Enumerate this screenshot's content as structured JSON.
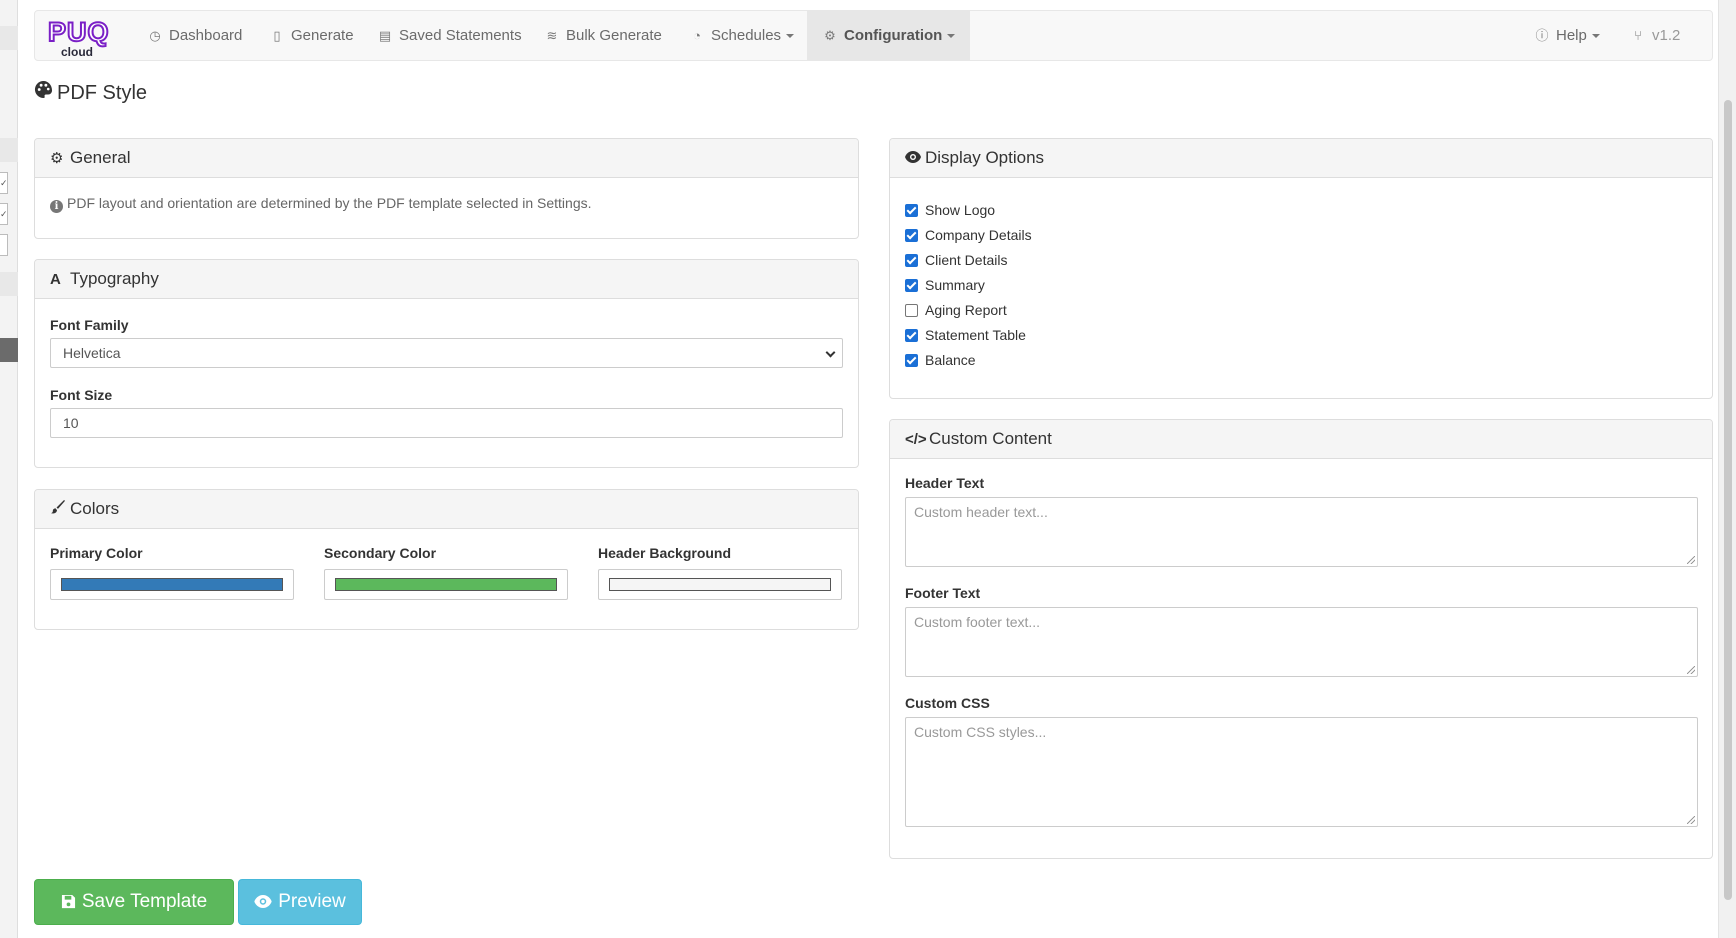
{
  "navbar": {
    "brand_text": "PUQ",
    "brand_sub": "cloud",
    "items": [
      {
        "label": "Dashboard",
        "icon": "dashboard-icon"
      },
      {
        "label": "Generate",
        "icon": "file-icon"
      },
      {
        "label": "Saved Statements",
        "icon": "archive-icon"
      },
      {
        "label": "Bulk Generate",
        "icon": "layers-icon"
      },
      {
        "label": "Schedules",
        "icon": "clock-icon"
      },
      {
        "label": "Configuration",
        "icon": "cogs-icon"
      }
    ],
    "help_label": "Help",
    "version": "v1.2"
  },
  "page": {
    "title": "PDF Style",
    "icon": "palette-icon"
  },
  "general": {
    "title": "General",
    "hint": "PDF layout and orientation are determined by the PDF template selected in Settings."
  },
  "typography": {
    "title": "Typography",
    "font_family_label": "Font Family",
    "font_family_value": "Helvetica",
    "font_size_label": "Font Size",
    "font_size_value": "10"
  },
  "colors": {
    "title": "Colors",
    "primary_label": "Primary Color",
    "primary_value": "#337ab7",
    "secondary_label": "Secondary Color",
    "secondary_value": "#5cb85c",
    "header_bg_label": "Header Background",
    "header_bg_value": "#f5f5f5"
  },
  "display_options": {
    "title": "Display Options",
    "items": [
      {
        "label": "Show Logo",
        "checked": true
      },
      {
        "label": "Company Details",
        "checked": true
      },
      {
        "label": "Client Details",
        "checked": true
      },
      {
        "label": "Summary",
        "checked": true
      },
      {
        "label": "Aging Report",
        "checked": false
      },
      {
        "label": "Statement Table",
        "checked": true
      },
      {
        "label": "Balance",
        "checked": true
      }
    ]
  },
  "custom_content": {
    "title": "Custom Content",
    "header_text_label": "Header Text",
    "header_text_placeholder": "Custom header text...",
    "footer_text_label": "Footer Text",
    "footer_text_placeholder": "Custom footer text...",
    "custom_css_label": "Custom CSS",
    "custom_css_placeholder": "Custom CSS styles..."
  },
  "actions": {
    "save_label": "Save Template",
    "preview_label": "Preview"
  }
}
